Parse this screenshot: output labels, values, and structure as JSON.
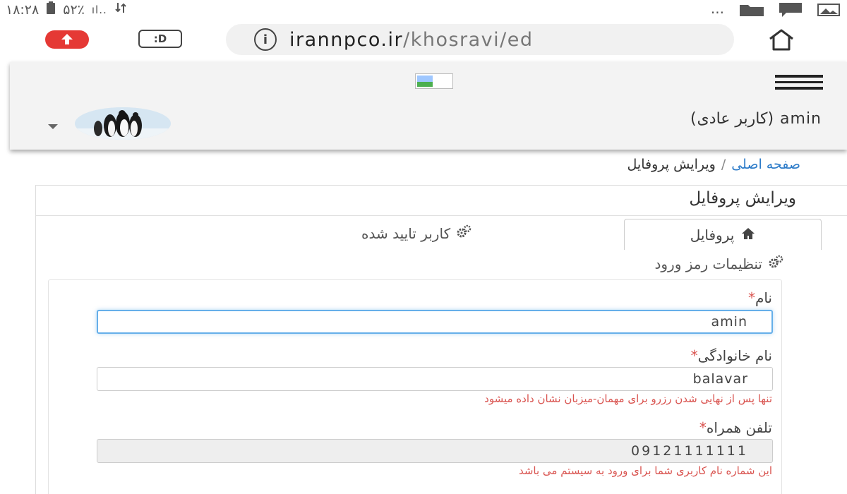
{
  "status_bar": {
    "time": "۱۸:۲۸",
    "battery": "۵۲٪",
    "signal": "ıl..",
    "notification_dots": "..."
  },
  "browser": {
    "url_host": "irannpco.ir",
    "url_path": "/khosravi/ed",
    "tab_count_label": ":D"
  },
  "header": {
    "user_name": "amin (کاربر عادی)"
  },
  "breadcrumb": {
    "home": "صفحه اصلی",
    "separator": "/",
    "current": "ویرایش پروفایل"
  },
  "panel": {
    "title": "ویرایش پروفایل"
  },
  "tabs": {
    "profile": "پروفایل",
    "verified_user": "کاربر تایید شده",
    "password_settings": "تنظیمات رمز ورود"
  },
  "form": {
    "first_name": {
      "label": "نام",
      "required_mark": "*",
      "value": "amin"
    },
    "last_name": {
      "label": "نام خانوادگی",
      "required_mark": "*",
      "value": "balavar",
      "hint": "تنها پس از نهایی شدن رزرو برای مهمان-میزبان نشان داده میشود"
    },
    "mobile": {
      "label": "تلفن همراه",
      "required_mark": "*",
      "value": "09121111111",
      "hint": "این شماره نام کاربری شما برای ورود به سیستم می باشد"
    }
  },
  "colors": {
    "link": "#2e7cc9",
    "required": "#d9534f",
    "focus_border": "#66afe9"
  }
}
